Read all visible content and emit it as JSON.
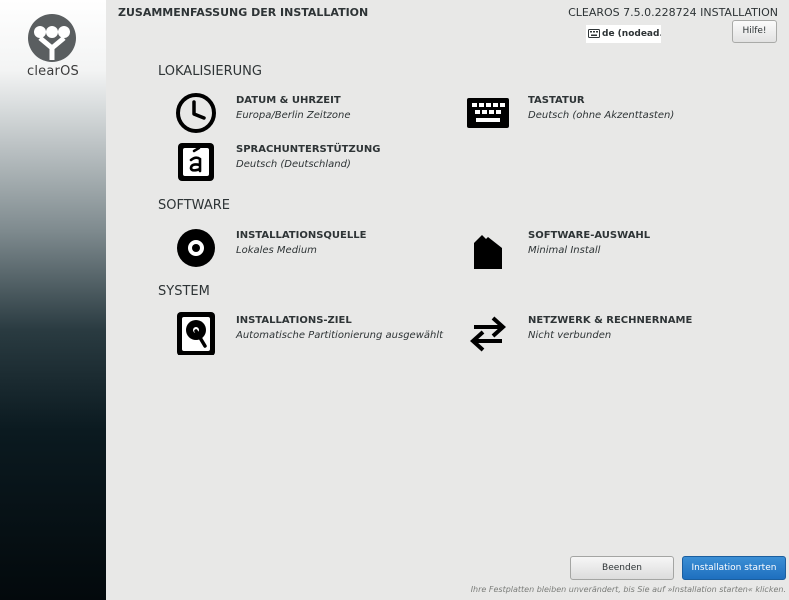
{
  "brand": {
    "logo_text": "clearOS"
  },
  "header": {
    "summary_title": "ZUSAMMENFASSUNG DER INSTALLATION",
    "product_title": "CLEAROS 7.5.0.228724 INSTALLATION",
    "keyboard_layout": "de (nodead...",
    "help_label": "Hilfe!"
  },
  "sections": {
    "localization": {
      "title": "LOKALISIERUNG",
      "datetime": {
        "name": "DATUM & UHRZEIT",
        "status": "Europa/Berlin Zeitzone",
        "icon": "clock-icon"
      },
      "keyboard": {
        "name": "TASTATUR",
        "status": "Deutsch (ohne Akzenttasten)",
        "icon": "keyboard-icon"
      },
      "language": {
        "name": "SPRACHUNTERSTÜTZUNG",
        "status": "Deutsch (Deutschland)",
        "icon": "language-icon"
      }
    },
    "software": {
      "title": "SOFTWARE",
      "source": {
        "name": "INSTALLATIONSQUELLE",
        "status": "Lokales Medium",
        "icon": "disc-icon"
      },
      "selection": {
        "name": "SOFTWARE-AUSWAHL",
        "status": "Minimal Install",
        "icon": "package-icon"
      }
    },
    "system": {
      "title": "SYSTEM",
      "destination": {
        "name": "INSTALLATIONS-ZIEL",
        "status": "Automatische Partitionierung ausgewählt",
        "icon": "harddisk-icon"
      },
      "network": {
        "name": "NETZWERK & RECHNERNAME",
        "status": "Nicht verbunden",
        "icon": "network-arrows-icon"
      }
    }
  },
  "footer": {
    "quit_label": "Beenden",
    "begin_label": "Installation starten",
    "note": "Ihre Festplatten bleiben unverändert, bis Sie auf »Installation starten« klicken."
  },
  "colors": {
    "accent": "#1e6fbf",
    "background": "#e8e8e7",
    "sidebar_dark": "#03090c"
  }
}
